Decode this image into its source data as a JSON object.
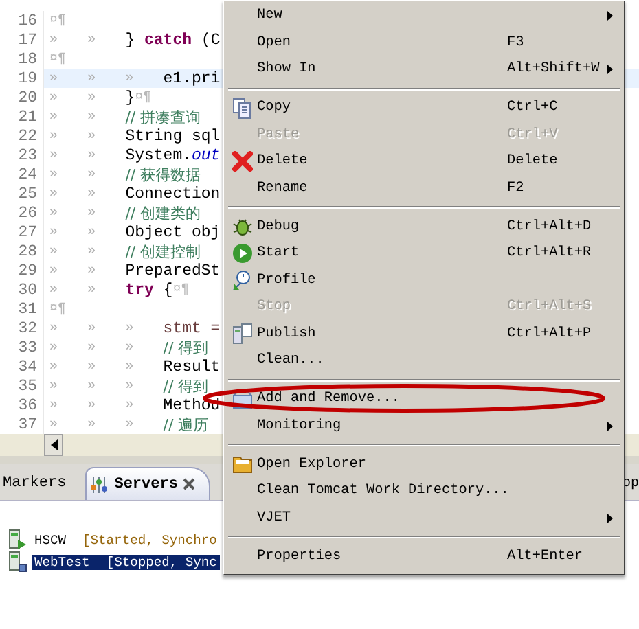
{
  "editor": {
    "lines": [
      {
        "number": "16",
        "eol": "¤¶",
        "current": false
      },
      {
        "number": "17",
        "tabs": [
          "»",
          "»"
        ],
        "segments": [
          {
            "kind": "plain",
            "text": "} "
          },
          {
            "kind": "keyword",
            "text": "catch"
          },
          {
            "kind": "plain",
            "text": " (C"
          }
        ],
        "current": false
      },
      {
        "number": "18",
        "eol": "¤¶",
        "current": false
      },
      {
        "number": "19",
        "tabs": [
          "»",
          "»",
          "»"
        ],
        "segments": [
          {
            "kind": "plain",
            "text": "e1.pri"
          }
        ],
        "current": true
      },
      {
        "number": "20",
        "tabs": [
          "»",
          "»"
        ],
        "segments": [
          {
            "kind": "plain",
            "text": "}"
          }
        ],
        "eol": "¤¶",
        "current": false
      },
      {
        "number": "21",
        "tabs": [
          "»",
          "»"
        ],
        "segments": [
          {
            "kind": "comment",
            "text": "// 拼凑查询"
          }
        ],
        "current": false
      },
      {
        "number": "22",
        "tabs": [
          "»",
          "»"
        ],
        "segments": [
          {
            "kind": "plain",
            "text": "String sql"
          }
        ],
        "current": false
      },
      {
        "number": "23",
        "tabs": [
          "»",
          "»"
        ],
        "segments": [
          {
            "kind": "plain",
            "text": "System."
          },
          {
            "kind": "field",
            "text": "out"
          }
        ],
        "current": false
      },
      {
        "number": "24",
        "tabs": [
          "»",
          "»"
        ],
        "segments": [
          {
            "kind": "comment",
            "text": "// 获得数据"
          }
        ],
        "current": false
      },
      {
        "number": "25",
        "tabs": [
          "»",
          "»"
        ],
        "segments": [
          {
            "kind": "plain",
            "text": "Connection"
          }
        ],
        "current": false
      },
      {
        "number": "26",
        "tabs": [
          "»",
          "»"
        ],
        "segments": [
          {
            "kind": "comment",
            "text": "// 创建类的"
          }
        ],
        "current": false
      },
      {
        "number": "27",
        "tabs": [
          "»",
          "»"
        ],
        "segments": [
          {
            "kind": "plain",
            "text": "Object obj"
          }
        ],
        "current": false
      },
      {
        "number": "28",
        "tabs": [
          "»",
          "»"
        ],
        "segments": [
          {
            "kind": "comment",
            "text": "// 创建控制"
          }
        ],
        "current": false
      },
      {
        "number": "29",
        "tabs": [
          "»",
          "»"
        ],
        "segments": [
          {
            "kind": "plain",
            "text": "PreparedSt"
          }
        ],
        "current": false
      },
      {
        "number": "30",
        "tabs": [
          "»",
          "»"
        ],
        "segments": [
          {
            "kind": "keyword",
            "text": "try"
          },
          {
            "kind": "plain",
            "text": " {"
          }
        ],
        "eol": "¤¶",
        "current": false
      },
      {
        "number": "31",
        "eol": "¤¶",
        "current": false
      },
      {
        "number": "32",
        "tabs": [
          "»",
          "»",
          "»"
        ],
        "segments": [
          {
            "kind": "local",
            "text": "stmt ="
          }
        ],
        "current": false
      },
      {
        "number": "33",
        "tabs": [
          "»",
          "»",
          "»"
        ],
        "segments": [
          {
            "kind": "comment",
            "text": "// 得到"
          }
        ],
        "current": false
      },
      {
        "number": "34",
        "tabs": [
          "»",
          "»",
          "»"
        ],
        "segments": [
          {
            "kind": "plain",
            "text": "Result"
          }
        ],
        "current": false
      },
      {
        "number": "35",
        "tabs": [
          "»",
          "»",
          "»"
        ],
        "segments": [
          {
            "kind": "comment",
            "text": "// 得到"
          }
        ],
        "current": false
      },
      {
        "number": "36",
        "tabs": [
          "»",
          "»",
          "»"
        ],
        "segments": [
          {
            "kind": "plain",
            "text": "Method"
          }
        ],
        "current": false
      },
      {
        "number": "37",
        "tabs": [
          "»",
          "»",
          "»"
        ],
        "segments": [
          {
            "kind": "comment",
            "text": "// 遍历"
          }
        ],
        "current": false
      }
    ]
  },
  "panel": {
    "tabs": [
      {
        "label": "Markers",
        "selected": false
      },
      {
        "label": "Servers",
        "selected": true
      }
    ],
    "right_text": "op",
    "servers": [
      {
        "name": "HSCW",
        "status": "[Started, Synchro",
        "selected": false
      },
      {
        "name": "WebTest",
        "status": "[Stopped, Sync",
        "selected": true
      }
    ]
  },
  "context_menu": {
    "items": [
      {
        "kind": "item",
        "label": "New",
        "disabled": false,
        "submenu": true
      },
      {
        "kind": "item",
        "label": "Open",
        "shortcut": "F3",
        "disabled": false,
        "submenu": false
      },
      {
        "kind": "item",
        "label": "Show In",
        "shortcut": "Alt+Shift+W",
        "disabled": false,
        "submenu": true
      },
      {
        "kind": "separator"
      },
      {
        "kind": "item",
        "label": "Copy",
        "shortcut": "Ctrl+C",
        "disabled": false,
        "submenu": false
      },
      {
        "kind": "item",
        "label": "Paste",
        "shortcut": "Ctrl+V",
        "disabled": true,
        "submenu": false
      },
      {
        "kind": "item",
        "label": "Delete",
        "shortcut": "Delete",
        "disabled": false,
        "submenu": false
      },
      {
        "kind": "item",
        "label": "Rename",
        "shortcut": "F2",
        "disabled": false,
        "submenu": false
      },
      {
        "kind": "separator"
      },
      {
        "kind": "item",
        "label": "Debug",
        "shortcut": "Ctrl+Alt+D",
        "disabled": false,
        "submenu": false
      },
      {
        "kind": "item",
        "label": "Start",
        "shortcut": "Ctrl+Alt+R",
        "disabled": false,
        "submenu": false
      },
      {
        "kind": "item",
        "label": "Profile",
        "disabled": false,
        "submenu": false
      },
      {
        "kind": "item",
        "label": "Stop",
        "shortcut": "Ctrl+Alt+S",
        "disabled": true,
        "submenu": false
      },
      {
        "kind": "item",
        "label": "Publish",
        "shortcut": "Ctrl+Alt+P",
        "disabled": false,
        "submenu": false
      },
      {
        "kind": "item",
        "label": "Clean...",
        "disabled": false,
        "submenu": false
      },
      {
        "kind": "separator"
      },
      {
        "kind": "item",
        "label": "Add and Remove...",
        "disabled": false,
        "submenu": false
      },
      {
        "kind": "item",
        "label": "Monitoring",
        "disabled": false,
        "submenu": true
      },
      {
        "kind": "separator"
      },
      {
        "kind": "item",
        "label": "Open Explorer",
        "disabled": false,
        "submenu": false
      },
      {
        "kind": "item",
        "label": "Clean Tomcat Work Directory...",
        "disabled": false,
        "submenu": false
      },
      {
        "kind": "item",
        "label": "VJET",
        "disabled": false,
        "submenu": true
      },
      {
        "kind": "separator"
      },
      {
        "kind": "item",
        "label": "Properties",
        "shortcut": "Alt+Enter",
        "disabled": false,
        "submenu": false
      }
    ]
  }
}
